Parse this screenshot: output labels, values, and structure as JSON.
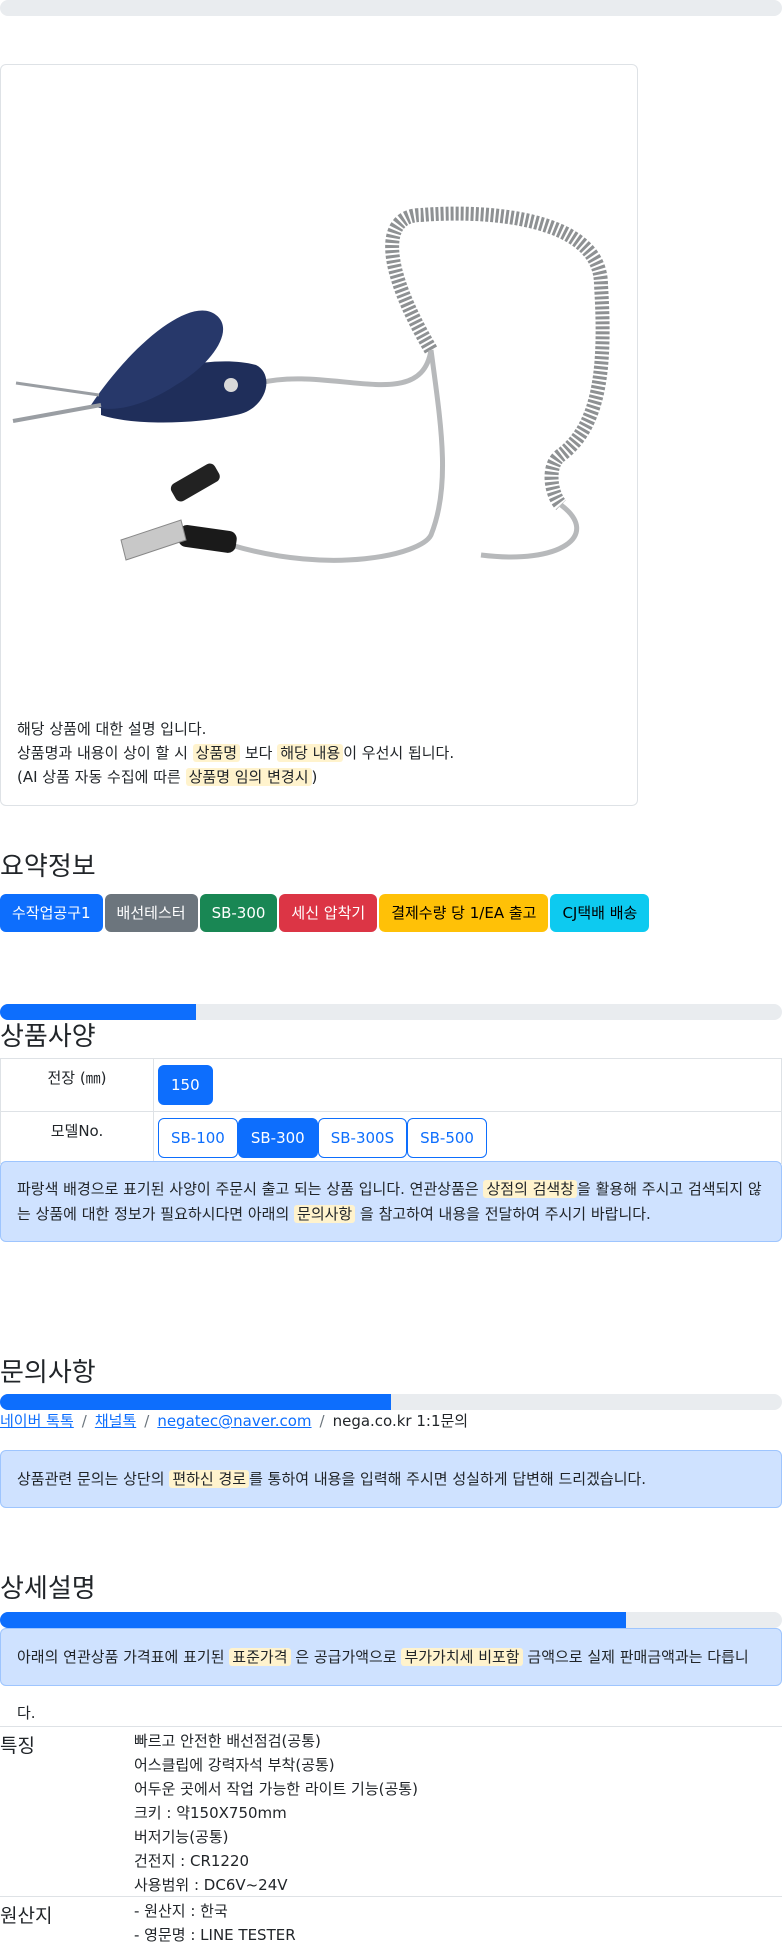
{
  "product_image_alt": "배선테스터 SB-300",
  "description": {
    "line1": "해당 상품에 대한 설명 입니다.",
    "line2_a": "상품명과 내용이 상이 할 시",
    "line2_b": "상품명",
    "line2_c": "보다",
    "line2_d": "해당 내용",
    "line2_e": "이 우선시 됩니다.",
    "line3_a": "(AI 상품 자동 수집에 따른",
    "line3_b": "상품명 임의 변경시",
    "line3_c": ")"
  },
  "summary": {
    "title": "요약정보",
    "badges": [
      {
        "label": "수작업공구1",
        "color": "#0d6efd",
        "text": "#ffffff"
      },
      {
        "label": "배선테스터",
        "color": "#6c757d",
        "text": "#ffffff"
      },
      {
        "label": "SB-300",
        "color": "#198754",
        "text": "#ffffff"
      },
      {
        "label": "세신 압착기",
        "color": "#dc3545",
        "text": "#ffffff"
      },
      {
        "label": "결제수량 당 1/EA 출고",
        "color": "#ffc107",
        "text": "#000000"
      },
      {
        "label": "CJ택배 배송",
        "color": "#0dcaf0",
        "text": "#000000"
      }
    ]
  },
  "specs": {
    "progress": 0.25,
    "title": "상품사양",
    "length_label": "전장 (㎜)",
    "length_value": "150",
    "model_label": "모델No.",
    "models": [
      "SB-100",
      "SB-300",
      "SB-300S",
      "SB-500"
    ],
    "selected_model": "SB-300",
    "notice_a": "파랑색 배경으로 표기된 사양이 주문시 출고 되는 상품 입니다. 연관상품은",
    "notice_b": "상점의 검색창",
    "notice_c": "을 활용해 주시고 검색되지 않",
    "notice_d": "는 상품에 대한 정보가 필요하시다면 아래의",
    "notice_e": "문의사항",
    "notice_f": "을 참고하여 내용을 전달하여 주시기 바랍니다."
  },
  "inquiry": {
    "title": "문의사항",
    "progress": 0.5,
    "links": [
      "네이버 톡톡",
      "채널톡",
      "negatec@naver.com"
    ],
    "text": "nega.co.kr 1:1문의",
    "notice_a": "상품관련 문의는 상단의",
    "notice_b": "편하신 경로",
    "notice_c": "를 통하여 내용을 입력해 주시면 성실하게 답변해 드리겠습니다."
  },
  "detail": {
    "title": "상세설명",
    "progress": 0.8,
    "notice_a": "아래의 연관상품 가격표에 표기된",
    "notice_b": "표준가격",
    "notice_c": "은 공급가액으로",
    "notice_d": "부가가치세 비포함",
    "notice_e": "금액으로 실제 판매금액과는 다릅니다."
  },
  "features": {
    "label": "특징",
    "items": [
      "빠르고 안전한 배선점검(공통)",
      "어스클립에 강력자석 부착(공통)",
      "어두운 곳에서 작업 가능한 라이트 기능(공통)",
      "크키 : 약150X750mm",
      "버저기능(공통)",
      "건전지 : CR1220",
      "사용범위 : DC6V~24V"
    ]
  },
  "origin": {
    "label": "원산지",
    "items": [
      "- 원산지 : 한국",
      "- 영문명 : LINE TESTER"
    ]
  }
}
